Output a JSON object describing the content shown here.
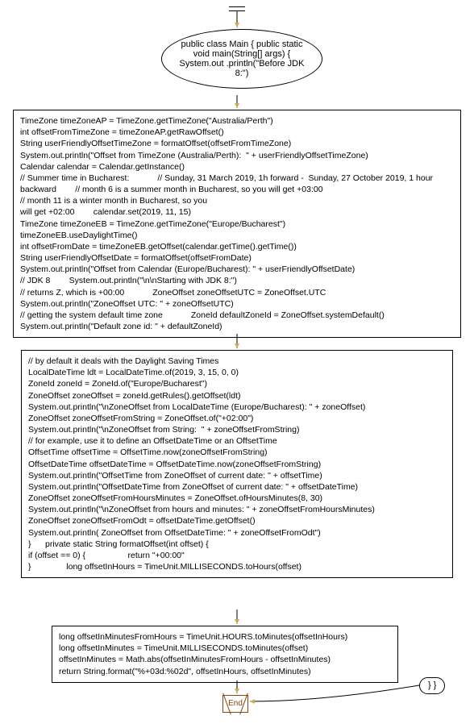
{
  "diagram": {
    "type": "flowchart",
    "nodes": {
      "start": "",
      "ellipse": "public class Main { public static void main(String[] args) {                System.out .println(\"Before JDK 8:\")",
      "box1": "TimeZone timeZoneAP = TimeZone.getTimeZone(\"Australia/Perth\")\nint offsetFromTimeZone = timeZoneAP.getRawOffset()\nString userFriendlyOffsetTimeZone = formatOffset(offsetFromTimeZone)\nSystem.out.println(\"Offset from TimeZone (Australia/Perth):  \" + userFriendlyOffsetTimeZone)\nCalendar calendar = Calendar.getInstance()\n// Summer time in Bucharest:            // Sunday, 31 March 2019, 1h forward -  Sunday, 27 October 2019, 1 hour backward        // month 6 is a summer month in Bucharest, so you will get +03:00\n// month 11 is a winter month in Bucharest, so you\nwill get +02:00        calendar.set(2019, 11, 15)\nTimeZone timeZoneEB = TimeZone.getTimeZone(\"Europe/Bucharest\")\ntimeZoneEB.useDaylightTime()\nint offsetFromDate = timeZoneEB.getOffset(calendar.getTime().getTime())\nString userFriendlyOffsetDate = formatOffset(offsetFromDate)\nSystem.out.println(\"Offset from Calendar (Europe/Bucharest): \" + userFriendlyOffsetDate)\n// JDK 8        System.out.println(\"\\n\\nStarting with JDK 8:\")\n// returns Z, which is +00:00            ZoneOffset zoneOffsetUTC = ZoneOffset.UTC\nSystem.out.println(\"ZoneOffset UTC: \" + zoneOffsetUTC)\n// getting the system default time zone            ZoneId defaultZoneId = ZoneOffset.systemDefault()\nSystem.out.println(\"Default zone id: \" + defaultZoneId)",
      "box2": "// by default it deals with the Daylight Saving Times\nLocalDateTime ldt = LocalDateTime.of(2019, 3, 15, 0, 0)\nZoneId zoneId = ZoneId.of(\"Europe/Bucharest\")\nZoneOffset zoneOffset = zoneId.getRules().getOffset(ldt)\nSystem.out.println(\"\\nZoneOffset from LocalDateTime (Europe/Bucharest): \" + zoneOffset)\nZoneOffset zoneOffsetFromString = ZoneOffset.of(\"+02:00\")\nSystem.out.println(\"\\nZoneOffset from String:  \" + zoneOffsetFromString)\n// for example, use it to define an OffsetDateTime or an OffsetTime\nOffsetTime offsetTime = OffsetTime.now(zoneOffsetFromString)\nOffsetDateTime offsetDateTime = OffsetDateTime.now(zoneOffsetFromString)\nSystem.out.println(\"OffsetTime from ZoneOffset of current date: \" + offsetTime)\nSystem.out.println(\"OffsetDateTime from ZoneOffset of current date: \" + offsetDateTime)\nZoneOffset zoneOffsetFromHoursMinutes = ZoneOffset.ofHoursMinutes(8, 30)\nSystem.out.println(\"\\nZoneOffset from hours and minutes: \" + zoneOffsetFromHoursMinutes)\nZoneOffset zoneOffsetFromOdt = offsetDateTime.getOffset()\nSystem.out.println( ZoneOffset from OffsetDateTime: \" + zoneOffsetFromOdt\")\n}      private static String formatOffset(int offset) {\nif (offset == 0) {                  return \"+00:00\"\n}               long offsetInHours = TimeUnit.MILLISECONDS.toHours(offset)",
      "box3": "long offsetInMinutesFromHours = TimeUnit.HOURS.toMinutes(offsetInHours)\nlong offsetInMinutes = TimeUnit.MILLISECONDS.toMinutes(offset)\noffsetInMinutes = Math.abs(offsetInMinutesFromHours - offsetInMinutes)\nreturn String.format(\"%+03d:%02d\", offsetInHours, offsetInMinutes)",
      "end": "End",
      "pill": "} }"
    },
    "edges": [
      {
        "from": "start",
        "to": "ellipse"
      },
      {
        "from": "ellipse",
        "to": "box1"
      },
      {
        "from": "box1",
        "to": "box2"
      },
      {
        "from": "box2",
        "to": "box3"
      },
      {
        "from": "box3",
        "to": "end"
      },
      {
        "from": "pill",
        "to": "end"
      }
    ]
  }
}
